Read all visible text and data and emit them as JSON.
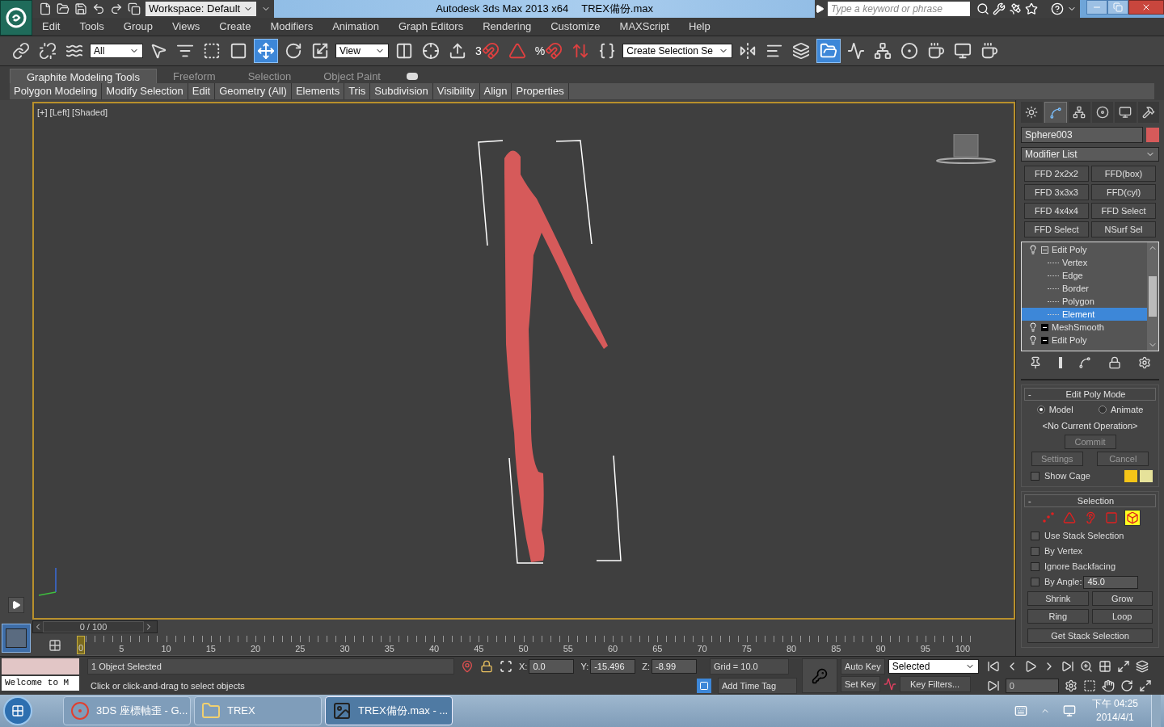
{
  "title_bar": {
    "workspace": "Workspace: Default",
    "title": "Autodesk 3ds Max  2013 x64",
    "filename": "TREX備份.max",
    "search": {
      "placeholder": "Type a keyword or phrase"
    }
  },
  "menu": [
    "Edit",
    "Tools",
    "Group",
    "Views",
    "Create",
    "Modifiers",
    "Animation",
    "Graph Editors",
    "Rendering",
    "Customize",
    "MAXScript",
    "Help"
  ],
  "toolbar": [
    {
      "kind": "link",
      "selected": false
    },
    {
      "kind": "unlink",
      "selected": false
    },
    {
      "kind": "bind",
      "selected": false
    },
    {
      "kind": "dropdown",
      "value": "All"
    },
    {
      "kind": "select",
      "selected": false
    },
    {
      "kind": "select-by-name",
      "selected": false
    },
    {
      "kind": "region",
      "selected": false
    },
    {
      "kind": "window-crossing",
      "selected": false
    },
    {
      "kind": "move",
      "selected": true
    },
    {
      "kind": "rotate",
      "selected": false
    },
    {
      "kind": "scale",
      "selected": false
    },
    {
      "kind": "dropdown",
      "value": "View"
    },
    {
      "kind": "pivot",
      "selected": false
    },
    {
      "kind": "manipulate",
      "selected": false
    },
    {
      "kind": "keyboard",
      "selected": false
    },
    {
      "kind": "snap",
      "label": "3",
      "selected": false
    },
    {
      "kind": "angle-snap",
      "selected": false
    },
    {
      "kind": "percent-snap",
      "label": "%",
      "selected": false
    },
    {
      "kind": "spinner-snap",
      "selected": false
    },
    {
      "kind": "edit-named",
      "selected": false
    },
    {
      "kind": "dropdown",
      "value": "Create Selection Se"
    },
    {
      "kind": "mirror",
      "selected": false
    },
    {
      "kind": "align",
      "selected": false
    },
    {
      "kind": "layers",
      "selected": false
    },
    {
      "kind": "explorer",
      "selected": true
    },
    {
      "kind": "curve-editor",
      "selected": false
    },
    {
      "kind": "schematic",
      "selected": false
    },
    {
      "kind": "material",
      "selected": false
    },
    {
      "kind": "render-setup",
      "selected": false
    },
    {
      "kind": "rendered-frame",
      "selected": false
    },
    {
      "kind": "render",
      "selected": false
    }
  ],
  "ribbon": {
    "tabs": [
      {
        "label": "Graphite Modeling Tools",
        "selected": true
      },
      {
        "label": "Freeform",
        "selected": false
      },
      {
        "label": "Selection",
        "selected": false
      },
      {
        "label": "Object Paint",
        "selected": false
      }
    ],
    "panels": [
      "Polygon Modeling",
      "Modify Selection",
      "Edit",
      "Geometry (All)",
      "Elements",
      "Tris",
      "Subdivision",
      "Visibility",
      "Align",
      "Properties"
    ]
  },
  "viewport": {
    "label": "[+] [Left] [Shaded]"
  },
  "command_panel": {
    "tabs": [
      {
        "kind": "create",
        "selected": false
      },
      {
        "kind": "modify",
        "selected": true
      },
      {
        "kind": "hierarchy",
        "selected": false
      },
      {
        "kind": "motion",
        "selected": false
      },
      {
        "kind": "display",
        "selected": false
      },
      {
        "kind": "utilities",
        "selected": false
      }
    ],
    "object": {
      "name": "Sphere003",
      "color": "#d65a5a"
    },
    "modifier_list": "Modifier List",
    "modifier_buttons": [
      "FFD 2x2x2",
      "FFD(box)",
      "FFD 3x3x3",
      "FFD(cyl)",
      "FFD 4x4x4",
      "FFD Select",
      "FFD Select",
      "NSurf Sel"
    ],
    "stack": [
      {
        "label": "Edit Poly",
        "expanded": true,
        "selected": false,
        "children": [
          {
            "label": "Vertex",
            "selected": false
          },
          {
            "label": "Edge",
            "selected": false
          },
          {
            "label": "Border",
            "selected": false
          },
          {
            "label": "Polygon",
            "selected": false
          },
          {
            "label": "Element",
            "selected": true
          }
        ]
      },
      {
        "label": "MeshSmooth",
        "expanded": false,
        "selected": false
      },
      {
        "label": "Edit Poly",
        "expanded": false,
        "selected": false
      }
    ],
    "edit_poly_mode": {
      "collapse": "-",
      "title": "Edit Poly Mode",
      "radios": [
        {
          "label": "Model",
          "selected": true
        },
        {
          "label": "Animate",
          "selected": false
        }
      ],
      "operation": "<No Current Operation>",
      "commit": {
        "label": "Commit",
        "disabled": true
      },
      "settings": {
        "label": "Settings",
        "disabled": true
      },
      "cancel": {
        "label": "Cancel",
        "disabled": true
      },
      "show_cage": {
        "label": "Show Cage",
        "checked": false
      },
      "cage_colors": [
        {
          "color": "#f5c518"
        },
        {
          "color": "#e6e29a"
        }
      ]
    },
    "selection": {
      "collapse": "-",
      "title": "Selection",
      "levels": [
        {
          "kind": "vertex",
          "selected": false
        },
        {
          "kind": "edge",
          "selected": false
        },
        {
          "kind": "border",
          "selected": false
        },
        {
          "kind": "polygon",
          "selected": false
        },
        {
          "kind": "element",
          "selected": true
        }
      ],
      "checks": [
        {
          "label": "Use Stack Selection",
          "checked": false
        },
        {
          "label": "By Vertex",
          "checked": false
        },
        {
          "label": "Ignore Backfacing",
          "checked": false
        },
        {
          "label": "By Angle:",
          "checked": false,
          "value": "45.0"
        }
      ],
      "buttons": [
        "Shrink",
        "Grow",
        "Ring",
        "Loop"
      ],
      "get_stack": "Get Stack Selection"
    }
  },
  "timeline": {
    "slider": "0 / 100",
    "level": 0,
    "labels": [
      "0",
      "5",
      "10",
      "15",
      "20",
      "25",
      "30",
      "35",
      "40",
      "45",
      "50",
      "55",
      "60",
      "65",
      "70",
      "75",
      "80",
      "85",
      "90",
      "95",
      "100"
    ]
  },
  "status": {
    "listener": "Welcome to M",
    "selected": "1 Object Selected",
    "prompt": "Click or click-and-drag to select objects",
    "coords": [
      {
        "label": "X:",
        "value": "0.0"
      },
      {
        "label": "Y:",
        "value": "-15.496"
      },
      {
        "label": "Z:",
        "value": "-8.99"
      }
    ],
    "grid": "Grid = 10.0",
    "time_tag": "Add Time Tag",
    "auto_key": "Auto Key",
    "set_key": "Set Key",
    "key_mode": "Selected",
    "key_filters": "Key Filters...",
    "frame": "0"
  },
  "taskbar": {
    "items": [
      {
        "kind": "browser",
        "label": "3DS 座標軸歪 - G...",
        "selected": false
      },
      {
        "kind": "folder",
        "label": "TREX",
        "selected": false
      },
      {
        "kind": "max",
        "label": "TREX備份.max - ...",
        "selected": true
      }
    ],
    "time": "下午 04:25",
    "date": "2014/4/1"
  }
}
